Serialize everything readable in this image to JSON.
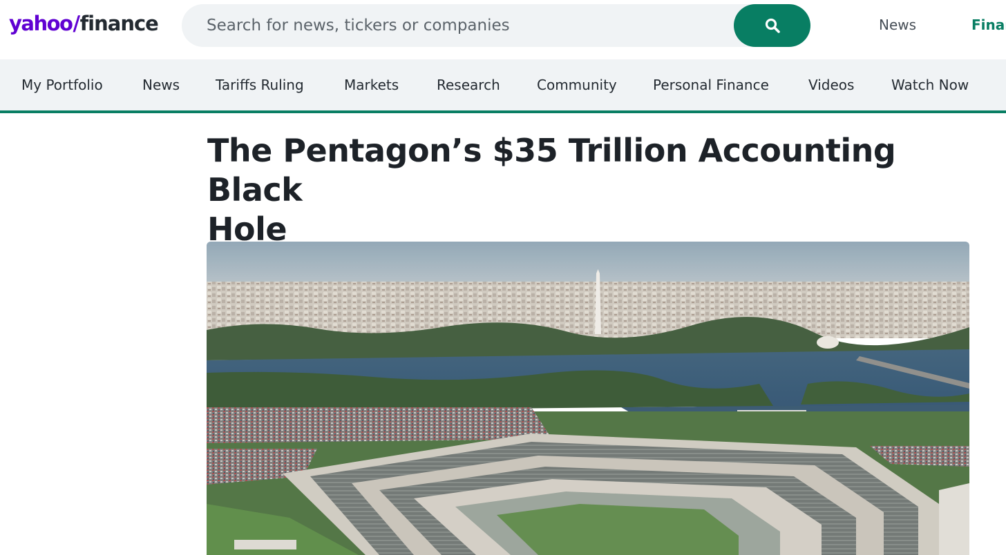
{
  "brand": {
    "logo_part1": "yahoo",
    "logo_slash": "/",
    "logo_part2": "finance",
    "primary_color": "#6001d2",
    "accent_color": "#087e63"
  },
  "search": {
    "placeholder": "Search for news, tickers or companies",
    "button_icon": "search-icon"
  },
  "top_links": [
    {
      "label": "News"
    },
    {
      "label": "Finar"
    }
  ],
  "nav": {
    "items": [
      {
        "label": "My Portfolio"
      },
      {
        "label": "News"
      },
      {
        "label": "Tariffs Ruling"
      },
      {
        "label": "Markets"
      },
      {
        "label": "Research"
      },
      {
        "label": "Community"
      },
      {
        "label": "Personal Finance"
      },
      {
        "label": "Videos"
      },
      {
        "label": "Watch Now"
      }
    ]
  },
  "article": {
    "headline_line1": "The Pentagon’s $35 Trillion Accounting Black",
    "headline_line2": "Hole"
  }
}
